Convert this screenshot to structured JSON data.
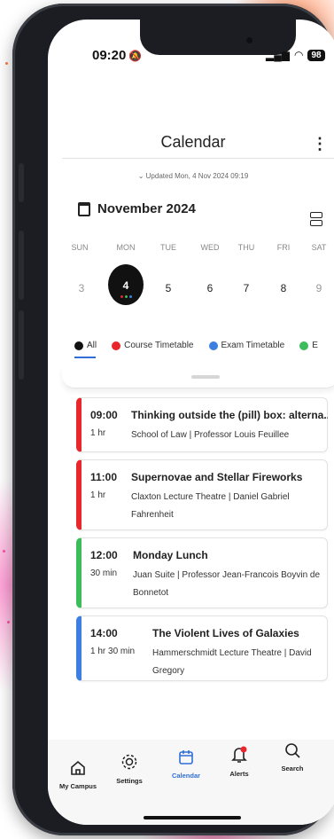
{
  "status_bar": {
    "time": "09:20",
    "battery": "98"
  },
  "header": {
    "title": "Calendar",
    "menu_icon": "kebab-icon",
    "updated": "Updated Mon, 4 Nov 2024 09:19"
  },
  "calendar": {
    "month_label": "November 2024",
    "weekdays": [
      "SUN",
      "MON",
      "TUE",
      "WED",
      "THU",
      "FRI",
      "SAT"
    ],
    "days": [
      "3",
      "4",
      "5",
      "6",
      "7",
      "8",
      "9"
    ],
    "selected_day": "4"
  },
  "filters": [
    {
      "label": "All",
      "color": "#111111"
    },
    {
      "label": "Course Timetable",
      "color": "#e8262b"
    },
    {
      "label": "Exam Timetable",
      "color": "#3d7fe0"
    },
    {
      "label": "E",
      "color": "#3cbc5a"
    }
  ],
  "events": [
    {
      "time": "09:00",
      "duration": "1 hr",
      "title": "Thinking outside the (pill) box: alterna...",
      "detail_lines": [
        "School of Law | Professor Louis Feuillee"
      ],
      "color": "#e8262b"
    },
    {
      "time": "11:00",
      "duration": "1 hr",
      "title": "Supernovae and Stellar Fireworks",
      "detail_lines": [
        "Claxton Lecture Theatre | Daniel Gabriel",
        "Fahrenheit"
      ],
      "color": "#e8262b"
    },
    {
      "time": "12:00",
      "duration": "30 min",
      "title": "Monday Lunch",
      "detail_lines": [
        "Juan Suite | Professor Jean-Francois Boyvin de",
        "Bonnetot"
      ],
      "color": "#3cbc5a"
    },
    {
      "time": "14:00",
      "duration": "1 hr 30 min",
      "title": "The Violent Lives of Galaxies",
      "detail_lines": [
        "Hammerschmidt Lecture Theatre | David",
        "Gregory"
      ],
      "color": "#3d7fe0"
    }
  ],
  "tabbar": [
    {
      "label": "My Campus",
      "icon": "home-icon"
    },
    {
      "label": "Settings",
      "icon": "gear-icon"
    },
    {
      "label": "Calendar",
      "icon": "calendar-icon",
      "active": true
    },
    {
      "label": "Alerts",
      "icon": "bell-icon"
    },
    {
      "label": "Search",
      "icon": "search-icon"
    }
  ],
  "accent_color": "#2f6fd6"
}
